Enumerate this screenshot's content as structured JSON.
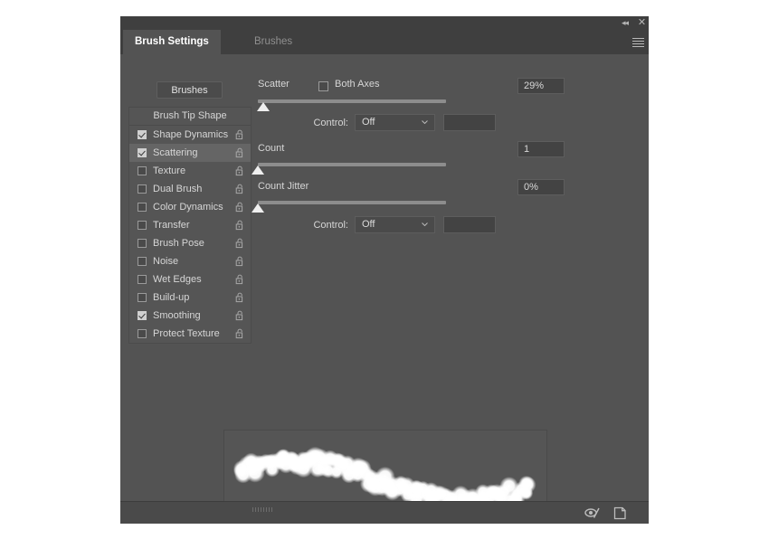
{
  "window": {
    "collapse_icon": "double-chevron-left-icon",
    "close_icon": "close-icon",
    "collapse_glyph": "◂◂",
    "close_glyph": "✕",
    "menu_icon": "hamburger-menu-icon"
  },
  "tabs": [
    {
      "label": "Brush Settings",
      "active": true
    },
    {
      "label": "Brushes",
      "active": false
    }
  ],
  "brushes_button": {
    "label": "Brushes"
  },
  "options_list": {
    "header": "Brush Tip Shape",
    "items": [
      {
        "label": "Shape Dynamics",
        "checked": true,
        "selected": false,
        "lock": "unlocked-padlock-icon"
      },
      {
        "label": "Scattering",
        "checked": true,
        "selected": true,
        "lock": "unlocked-padlock-icon"
      },
      {
        "label": "Texture",
        "checked": false,
        "selected": false,
        "lock": "unlocked-padlock-icon"
      },
      {
        "label": "Dual Brush",
        "checked": false,
        "selected": false,
        "lock": "unlocked-padlock-icon"
      },
      {
        "label": "Color Dynamics",
        "checked": false,
        "selected": false,
        "lock": "unlocked-padlock-icon"
      },
      {
        "label": "Transfer",
        "checked": false,
        "selected": false,
        "lock": "unlocked-padlock-icon"
      },
      {
        "label": "Brush Pose",
        "checked": false,
        "selected": false,
        "lock": "unlocked-padlock-icon"
      },
      {
        "label": "Noise",
        "checked": false,
        "selected": false,
        "lock": "unlocked-padlock-icon"
      },
      {
        "label": "Wet Edges",
        "checked": false,
        "selected": false,
        "lock": "unlocked-padlock-icon"
      },
      {
        "label": "Build-up",
        "checked": false,
        "selected": false,
        "lock": "unlocked-padlock-icon"
      },
      {
        "label": "Smoothing",
        "checked": true,
        "selected": false,
        "lock": "unlocked-padlock-icon"
      },
      {
        "label": "Protect Texture",
        "checked": false,
        "selected": false,
        "lock": "unlocked-padlock-icon"
      }
    ]
  },
  "scattering": {
    "scatter_label": "Scatter",
    "both_axes_label": "Both Axes",
    "both_axes_checked": false,
    "scatter_value": "29%",
    "scatter_slider_percent": 3,
    "scatter_control_label": "Control:",
    "scatter_control_value": "Off",
    "scatter_control_extra": "",
    "count_label": "Count",
    "count_value": "1",
    "count_slider_percent": 0,
    "count_jitter_label": "Count Jitter",
    "count_jitter_value": "0%",
    "count_jitter_slider_percent": 0,
    "jitter_control_label": "Control:",
    "jitter_control_value": "Off",
    "jitter_control_extra": ""
  },
  "preview": {
    "name": "brush-stroke-preview",
    "stroke_color": "#ffffff",
    "background_color": "#555555"
  },
  "footer": {
    "toggle_icon": "brush-preview-toggle-icon",
    "new_brush_icon": "new-brush-preset-icon"
  }
}
